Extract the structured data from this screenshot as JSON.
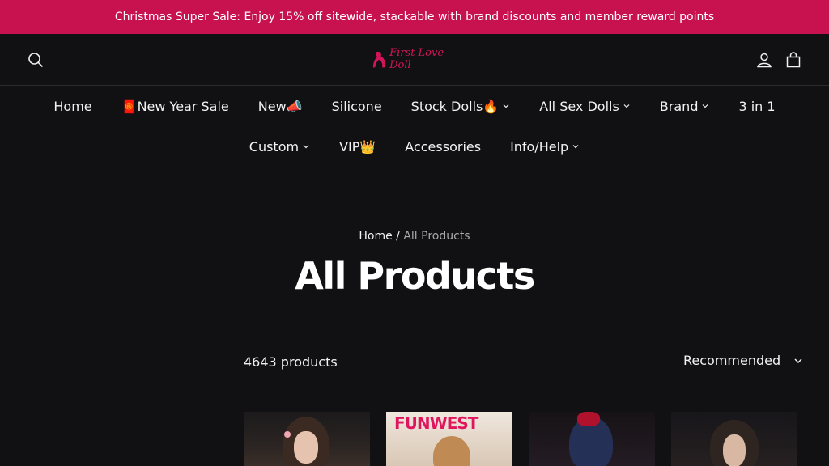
{
  "announcement": {
    "text": "Christmas Super Sale: Enjoy 15% off sitewide, stackable with brand discounts and member reward points"
  },
  "header": {
    "logo_text": "First Love Doll",
    "icons": {
      "search": "search-icon",
      "account": "user-icon",
      "cart": "bag-icon"
    }
  },
  "nav": {
    "row1": [
      {
        "label": "Home",
        "dropdown": false
      },
      {
        "label": "🧧New Year Sale",
        "dropdown": false
      },
      {
        "label": "New📣",
        "dropdown": false
      },
      {
        "label": "Silicone",
        "dropdown": false
      },
      {
        "label": "Stock Dolls🔥",
        "dropdown": true
      },
      {
        "label": "All Sex Dolls",
        "dropdown": true
      },
      {
        "label": "Brand",
        "dropdown": true
      },
      {
        "label": "3 in 1",
        "dropdown": false
      }
    ],
    "row2": [
      {
        "label": "Custom",
        "dropdown": true
      },
      {
        "label": "VIP👑",
        "dropdown": false
      },
      {
        "label": "Accessories",
        "dropdown": false
      },
      {
        "label": "Info/Help",
        "dropdown": true
      }
    ]
  },
  "breadcrumb": {
    "home": "Home",
    "separator": "/",
    "current": "All Products"
  },
  "page": {
    "title": "All Products"
  },
  "toolbar": {
    "count": "4643 products",
    "sort_label": "Recommended"
  },
  "products": [
    {
      "tag": ""
    },
    {
      "tag": "FUNWEST"
    },
    {
      "tag": ""
    },
    {
      "tag": ""
    }
  ],
  "colors": {
    "accent": "#c8124f",
    "background": "#111012"
  }
}
